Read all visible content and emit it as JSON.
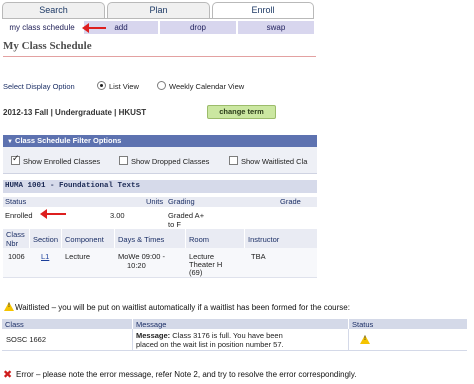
{
  "tabs": [
    {
      "label": "Search",
      "active": false
    },
    {
      "label": "Plan",
      "active": false
    },
    {
      "label": "Enroll",
      "active": true
    }
  ],
  "subtabs": [
    {
      "label": "my class schedule",
      "active": true
    },
    {
      "label": "add",
      "active": false
    },
    {
      "label": "drop",
      "active": false
    },
    {
      "label": "swap",
      "active": false
    }
  ],
  "page_title": "My Class Schedule",
  "display_option": {
    "label": "Select Display Option",
    "options": [
      {
        "label": "List View",
        "selected": true
      },
      {
        "label": "Weekly Calendar View",
        "selected": false
      }
    ]
  },
  "term_text": "2012-13 Fall | Undergraduate | HKUST",
  "change_term_label": "change term",
  "filter": {
    "title": "Class Schedule Filter Options",
    "options": [
      {
        "label": "Show Enrolled Classes",
        "checked": true
      },
      {
        "label": "Show Dropped Classes",
        "checked": false
      },
      {
        "label": "Show Waitlisted Cla",
        "checked": false
      }
    ]
  },
  "course": {
    "title": "HUMA 1001 - Foundational Texts",
    "summary_headers": [
      "Status",
      "Units",
      "Grading",
      "Grade"
    ],
    "summary_row": {
      "status": "Enrolled",
      "units": "3.00",
      "grading_line1": "Graded A+",
      "grading_line2": "to F"
    },
    "class_headers": {
      "class_nbr_1": "Class",
      "class_nbr_2": "Nbr",
      "section": "Section",
      "component": "Component",
      "days_times": "Days & Times",
      "room": "Room",
      "instructor": "Instructor"
    },
    "class_row": {
      "class_nbr": "1006",
      "section": "L1",
      "component": "Lecture",
      "days_times_1": "MoWe 09:00 -",
      "days_times_2": "10:20",
      "room_1": "Lecture",
      "room_2": "Theater H",
      "room_3": "(69)",
      "instructor": "TBA"
    }
  },
  "waitlist_note": "Waitlisted – you will be put on waitlist automatically if a waitlist has been formed for the course:",
  "waitlist_table": {
    "headers": [
      "Class",
      "Message",
      "Status"
    ],
    "row": {
      "class": "SOSC 1662",
      "message_bold": "Message:",
      "message_1": " Class 3176 is full. You have been",
      "message_2": "placed on the wait list in position number 57."
    }
  },
  "error_note": "Error – please note the error message, refer Note 2, and try to resolve the error correspondingly.",
  "colors": {
    "filter_bar": "#5d72b0",
    "change_term_bg": "#cbe7a1",
    "annotation_arrow": "#dd1f1f",
    "warning": "#f5c400",
    "error": "#cf1d1d"
  }
}
